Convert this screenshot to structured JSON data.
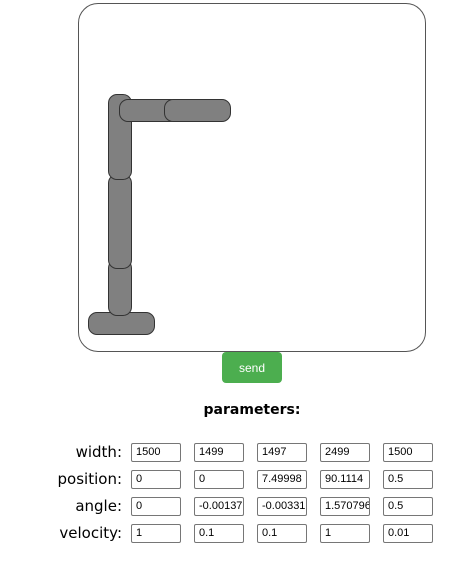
{
  "send_label": "send",
  "params_heading": "parameters:",
  "rows": [
    {
      "label": "width:",
      "values": [
        "1500",
        "1499",
        "1497",
        "2499",
        "1500"
      ]
    },
    {
      "label": "position:",
      "values": [
        "0",
        "0",
        "7.49998",
        "90.1114",
        "0.5"
      ]
    },
    {
      "label": "angle:",
      "values": [
        "0",
        "-0.00137",
        "-0.00331",
        "1.570796",
        "0.5"
      ]
    },
    {
      "label": "velocity:",
      "values": [
        "1",
        "0.1",
        "0.1",
        "1",
        "0.01"
      ]
    }
  ]
}
